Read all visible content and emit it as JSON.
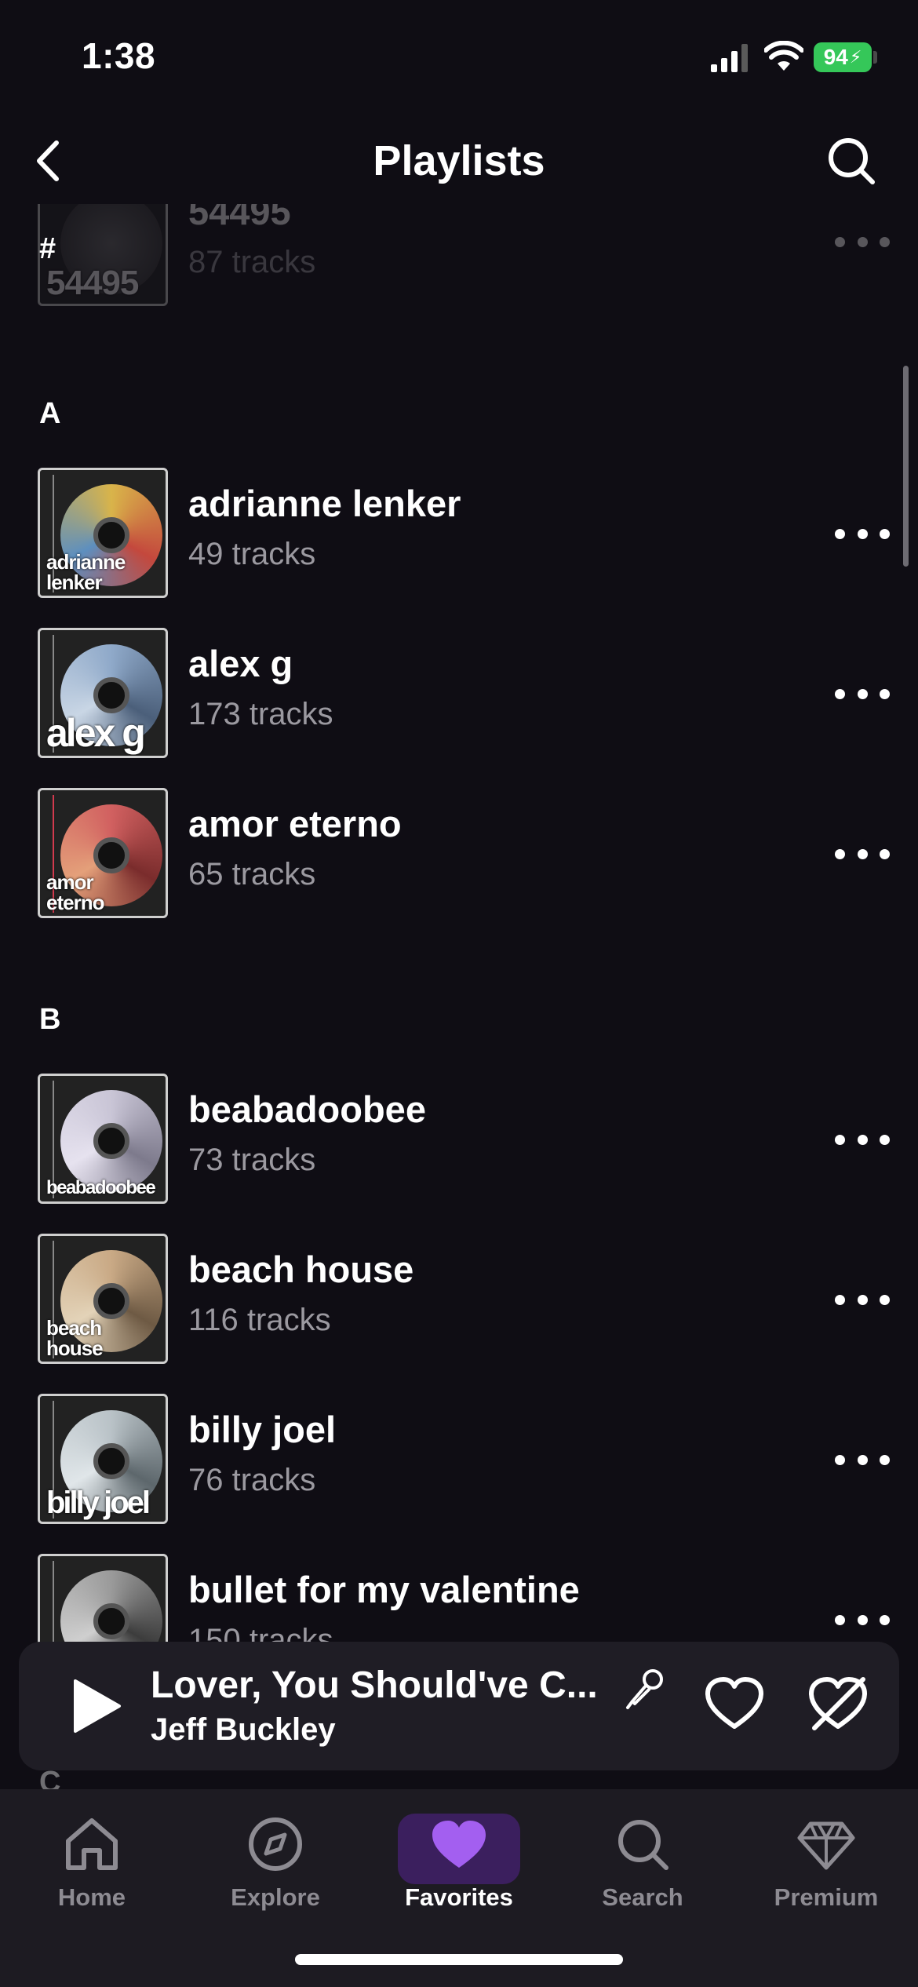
{
  "status_bar": {
    "time": "1:38",
    "battery": "94"
  },
  "header": {
    "title": "Playlists"
  },
  "sections": [
    {
      "letter": "#",
      "items": [
        {
          "name": "54495",
          "tracks": "87 tracks",
          "cover_text": "54495",
          "colors": [
            "#6a6a6a",
            "#2a2a2a"
          ]
        }
      ]
    },
    {
      "letter": "A",
      "items": [
        {
          "name": "adrianne lenker",
          "tracks": "49 tracks",
          "cover_text": "adrianne lenker",
          "colors": [
            "#d9b44a",
            "#c4483d"
          ]
        },
        {
          "name": "alex g",
          "tracks": "173 tracks",
          "cover_text": "alex g",
          "colors": [
            "#8fa9c9",
            "#4b5f7a"
          ]
        },
        {
          "name": "amor eterno",
          "tracks": "65 tracks",
          "cover_text": "amor eterno",
          "colors": [
            "#d16060",
            "#7a2c2c"
          ]
        }
      ]
    },
    {
      "letter": "B",
      "items": [
        {
          "name": "beabadoobee",
          "tracks": "73 tracks",
          "cover_text": "beabadoobee",
          "colors": [
            "#c9c5d6",
            "#7d7a8c"
          ]
        },
        {
          "name": "beach house",
          "tracks": "116 tracks",
          "cover_text": "beach house",
          "colors": [
            "#c9a985",
            "#6e5a44"
          ]
        },
        {
          "name": "billy joel",
          "tracks": "76 tracks",
          "cover_text": "billy joel",
          "colors": [
            "#b9c2c7",
            "#5d676c"
          ]
        },
        {
          "name": "bullet for my valentine",
          "tracks": "150 tracks",
          "cover_text": "",
          "colors": [
            "#9a9a9a",
            "#3c3c3c"
          ]
        }
      ]
    }
  ],
  "next_section_letter": "C",
  "now_playing": {
    "title": "Lover, You Should've C...",
    "artist": "Jeff Buckley"
  },
  "tabs": [
    {
      "label": "Home",
      "icon": "home-icon"
    },
    {
      "label": "Explore",
      "icon": "compass-icon"
    },
    {
      "label": "Favorites",
      "icon": "heart-icon"
    },
    {
      "label": "Search",
      "icon": "search-icon"
    },
    {
      "label": "Premium",
      "icon": "diamond-icon"
    }
  ],
  "colors": {
    "background": "#0f0d14",
    "accent": "#a35ff0",
    "battery": "#35c759"
  }
}
